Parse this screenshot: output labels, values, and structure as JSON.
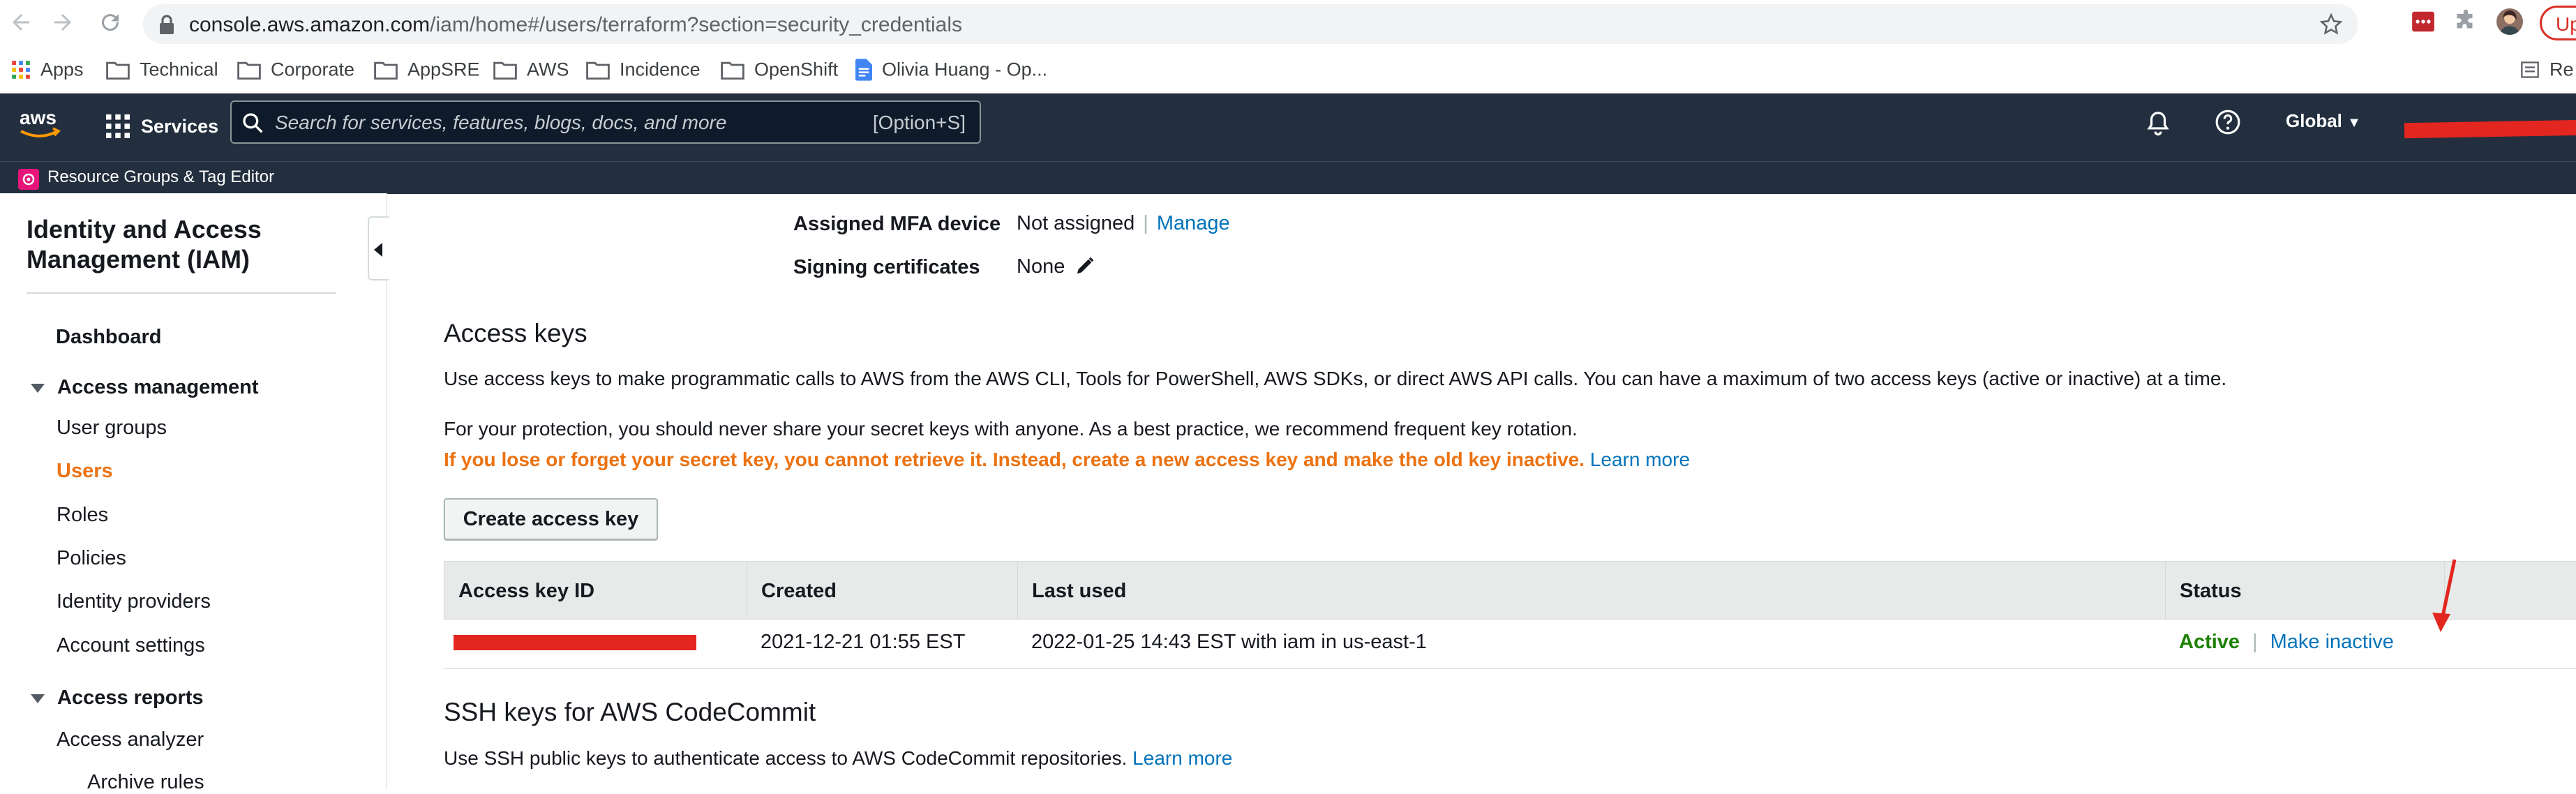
{
  "browser": {
    "url_host": "console.aws.amazon.com",
    "url_path": "/iam/home#/users/terraform?section=security_credentials",
    "update_label": "Up",
    "bookmarks": [
      {
        "label": "Apps",
        "icon": "apps-grid-icon"
      },
      {
        "label": "Technical",
        "icon": "folder-icon"
      },
      {
        "label": "Corporate",
        "icon": "folder-icon"
      },
      {
        "label": "AppSRE",
        "icon": "folder-icon"
      },
      {
        "label": "AWS",
        "icon": "folder-icon"
      },
      {
        "label": "Incidence",
        "icon": "folder-icon"
      },
      {
        "label": "OpenShift",
        "icon": "folder-icon"
      },
      {
        "label": "Olivia Huang - Op...",
        "icon": "google-doc-icon"
      }
    ],
    "reading_list_label": "Re"
  },
  "aws_nav": {
    "logo_text": "aws",
    "services_label": "Services",
    "search_placeholder": "Search for services, features, blogs, docs, and more",
    "search_shortcut": "[Option+S]",
    "region_label": "Global",
    "subnav_label": "Resource Groups & Tag Editor"
  },
  "sidebar": {
    "title": "Identity and Access Management (IAM)",
    "dashboard": "Dashboard",
    "access_management": "Access management",
    "items": [
      "User groups",
      "Users",
      "Roles",
      "Policies",
      "Identity providers",
      "Account settings"
    ],
    "access_reports": "Access reports",
    "reports_items": [
      "Access analyzer",
      "Archive rules"
    ]
  },
  "main": {
    "mfa_label": "Assigned MFA device",
    "mfa_value": "Not assigned",
    "mfa_link": "Manage",
    "signing_label": "Signing certificates",
    "signing_value": "None",
    "access_keys_title": "Access keys",
    "access_keys_desc": "Use access keys to make programmatic calls to AWS from the AWS CLI, Tools for PowerShell, AWS SDKs, or direct AWS API calls. You can have a maximum of two access keys (active or inactive) at a time.",
    "protection_text": "For your protection, you should never share your secret keys with anyone. As a best practice, we recommend frequent key rotation.",
    "warning_text": "If you lose or forget your secret key, you cannot retrieve it. Instead, create a new access key and make the old key inactive.",
    "learn_more": "Learn more",
    "create_key_button": "Create access key",
    "table": {
      "headers": [
        "Access key ID",
        "Created",
        "Last used",
        "Status"
      ],
      "rows": [
        {
          "created": "2021-12-21 01:55 EST",
          "last_used": "2022-01-25 14:43 EST with iam in us-east-1",
          "status": "Active",
          "action": "Make inactive"
        }
      ]
    },
    "ssh_title": "SSH keys for AWS CodeCommit",
    "ssh_desc": "Use SSH public keys to authenticate access to AWS CodeCommit repositories.",
    "ssh_learn_more": "Learn more"
  },
  "colors": {
    "aws_nav_bg": "#232f3e",
    "link": "#0073bb",
    "warning": "#ec7211",
    "active_status": "#1d8102",
    "annotation_red": "#e3261f"
  }
}
